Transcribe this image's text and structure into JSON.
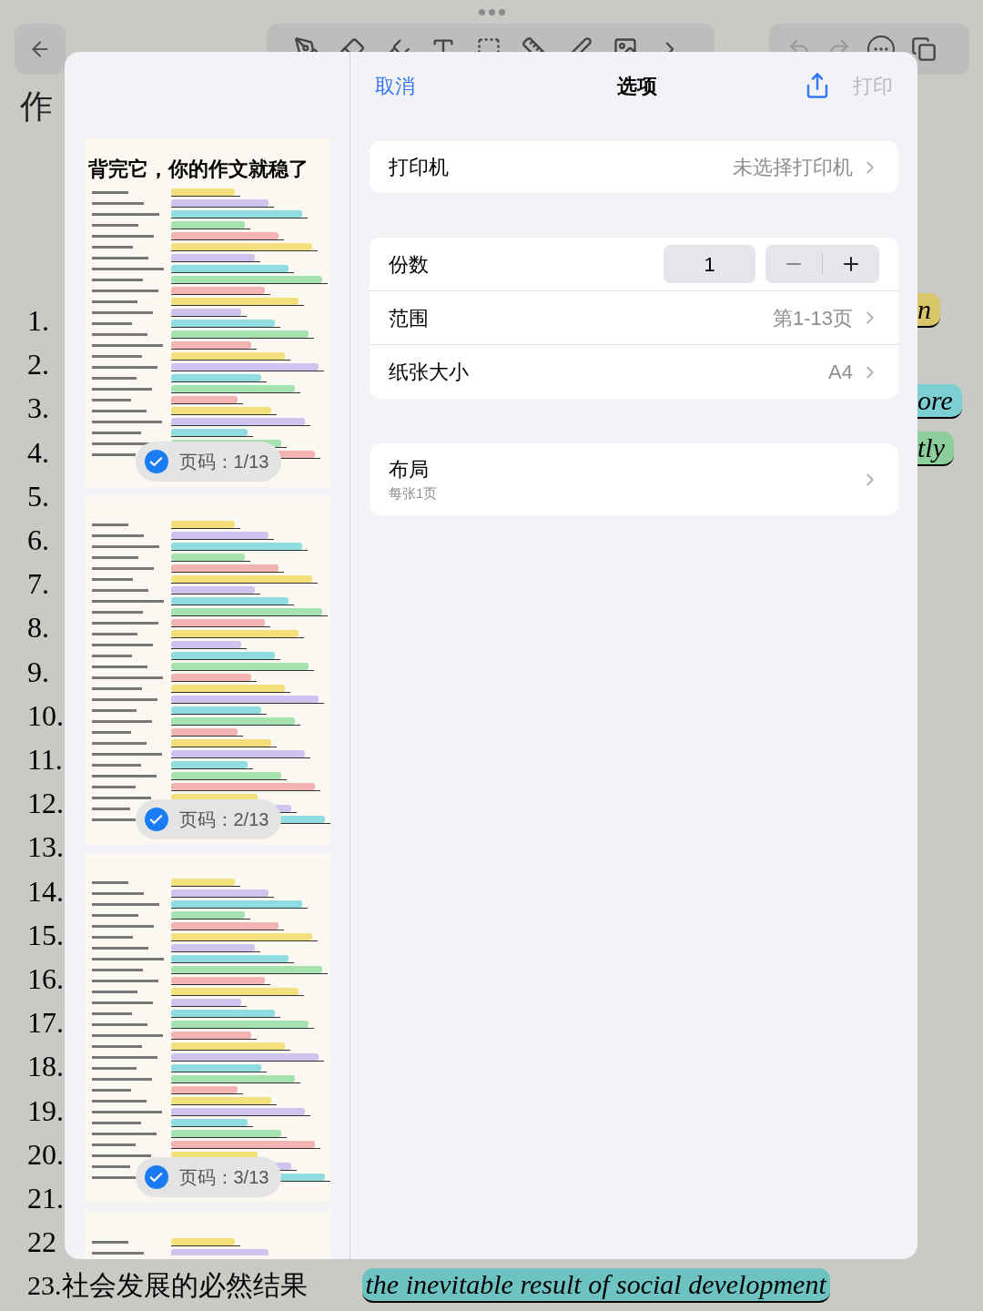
{
  "note": {
    "title": "作",
    "list": [
      {
        "text": "1."
      },
      {
        "text": "2."
      },
      {
        "text": "3."
      },
      {
        "text": "4."
      },
      {
        "text": "5."
      },
      {
        "text": "6."
      },
      {
        "text": "7."
      },
      {
        "text": "8."
      },
      {
        "text": "9."
      },
      {
        "text": "10."
      },
      {
        "text": "11."
      },
      {
        "text": "12."
      },
      {
        "text": "13."
      },
      {
        "text": "14."
      },
      {
        "text": "15."
      },
      {
        "text": "16."
      },
      {
        "text": "17."
      },
      {
        "text": "18."
      },
      {
        "text": "19."
      },
      {
        "text": "20."
      },
      {
        "text": "21."
      },
      {
        "text": "22"
      }
    ],
    "right_fragments": [
      {
        "text": "n",
        "color": "#d8c66a"
      },
      {
        "text": "ore",
        "color": "#7ccfd3"
      },
      {
        "text": "tly",
        "color": "#8ccf9c"
      }
    ],
    "bottom_line": {
      "chinese": "23.社会发展的必然结果",
      "english": "the inevitable result of social development",
      "color": "#6cc3c2"
    }
  },
  "print_dialog": {
    "cancel": "取消",
    "title": "选项",
    "print": {
      "label": "打印",
      "disabled": true
    },
    "pages": [
      {
        "heading": "背完它，你的作文就稳了",
        "label": "页码：1/13",
        "selected": true
      },
      {
        "label": "页码：2/13",
        "selected": true
      },
      {
        "label": "页码：3/13",
        "selected": true
      },
      {
        "kind": "partial"
      }
    ],
    "printer": {
      "label": "打印机",
      "value": "未选择打印机"
    },
    "copies": {
      "label": "份数",
      "value": "1"
    },
    "range": {
      "label": "范围",
      "value": "第1-13页"
    },
    "paper_size": {
      "label": "纸张大小",
      "value": "A4"
    },
    "layout": {
      "label": "布局",
      "value": "每张1页"
    }
  }
}
